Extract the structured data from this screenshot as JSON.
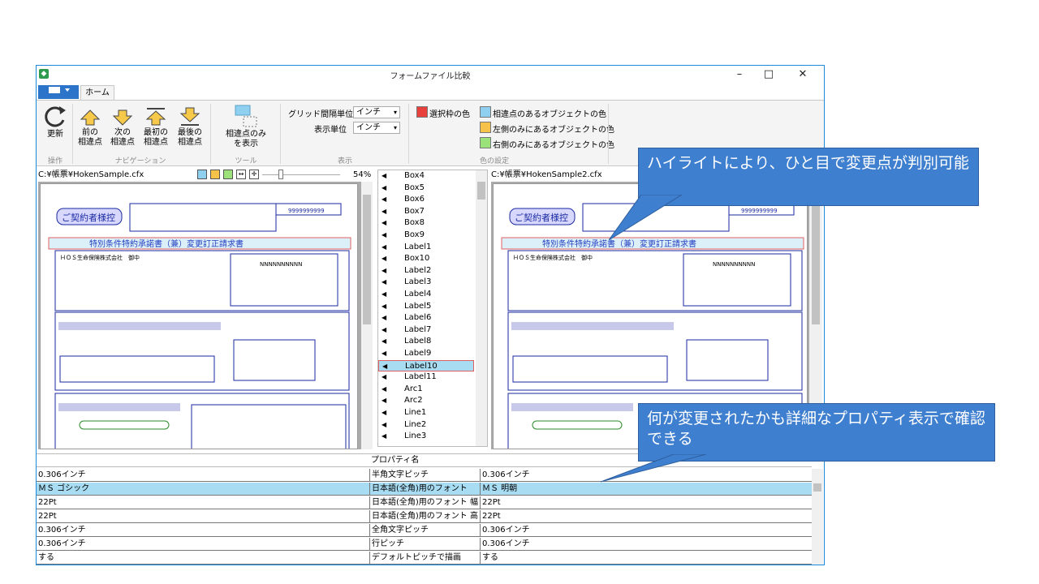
{
  "window": {
    "title": "フォームファイル比較",
    "minimize": "–",
    "maximize": "□",
    "close": "✕"
  },
  "ribbon": {
    "home_tab": "ホーム",
    "refresh": "更新",
    "prev": "前の\n相違点",
    "next": "次の\n相違点",
    "first": "最初の\n相違点",
    "last": "最後の\n相違点",
    "diff_only": "相違点のみ\nを表示",
    "groups": {
      "op": "操作",
      "nav": "ナビゲーション",
      "tool": "ツール",
      "view": "表示",
      "color": "色の設定"
    },
    "grid_unit_label": "グリッド間隔単位",
    "grid_unit_value": "インチ",
    "display_unit_label": "表示単位",
    "display_unit_value": "インチ",
    "sel_frame_color": "選択枠の色",
    "diff_obj_color": "相違点のあるオブジェクトの色",
    "left_only_color": "左側のみにあるオブジェクトの色",
    "right_only_color": "右側のみにあるオブジェクトの色",
    "colors": {
      "sel": "#e8403c",
      "diff": "#8fd0f0",
      "left": "#f6c24a",
      "right": "#9be27a"
    }
  },
  "left_pane": {
    "path": "C:¥帳票¥HokenSample.cfx",
    "zoom": "54%"
  },
  "right_pane": {
    "path": "C:¥帳票¥HokenSample2.cfx"
  },
  "object_list": [
    "Box4",
    "Box5",
    "Box6",
    "Box7",
    "Box8",
    "Box9",
    "Label1",
    "Box10",
    "Label2",
    "Label3",
    "Label4",
    "Label5",
    "Label6",
    "Label7",
    "Label8",
    "Label9",
    "Label10",
    "Label11",
    "Arc1",
    "Arc2",
    "Line1",
    "Line2",
    "Line3"
  ],
  "selected_object": "Label10",
  "properties": {
    "header": "プロパティ名",
    "rows": [
      {
        "left": "0.306インチ",
        "name": "半角文字ピッチ",
        "right": "0.306インチ"
      },
      {
        "left": "ＭＳ ゴシック",
        "name": "日本語(全角)用のフォント",
        "right": "ＭＳ 明朝"
      },
      {
        "left": "22Pt",
        "name": "日本語(全角)用のフォント 幅",
        "right": "22Pt"
      },
      {
        "left": "22Pt",
        "name": "日本語(全角)用のフォント 高さ",
        "right": "22Pt"
      },
      {
        "left": "0.306インチ",
        "name": "全角文字ピッチ",
        "right": "0.306インチ"
      },
      {
        "left": "0.306インチ",
        "name": "行ピッチ",
        "right": "0.306インチ"
      },
      {
        "left": "する",
        "name": "デフォルトピッチで描画",
        "right": "する"
      }
    ]
  },
  "form": {
    "title": "ご契約者様控",
    "main_title": "特別条件特約承諾書（兼）変更訂正請求書",
    "company": "ＨＯＳ生命保険株式会社　御中",
    "number": "9999999999",
    "name_placeholder": "NNNNNNNNNN"
  },
  "callouts": {
    "top": "ハイライトにより、ひと目で変更点が判別可能",
    "bottom": "何が変更されたかも詳細なプロパティ表示で確認できる"
  }
}
